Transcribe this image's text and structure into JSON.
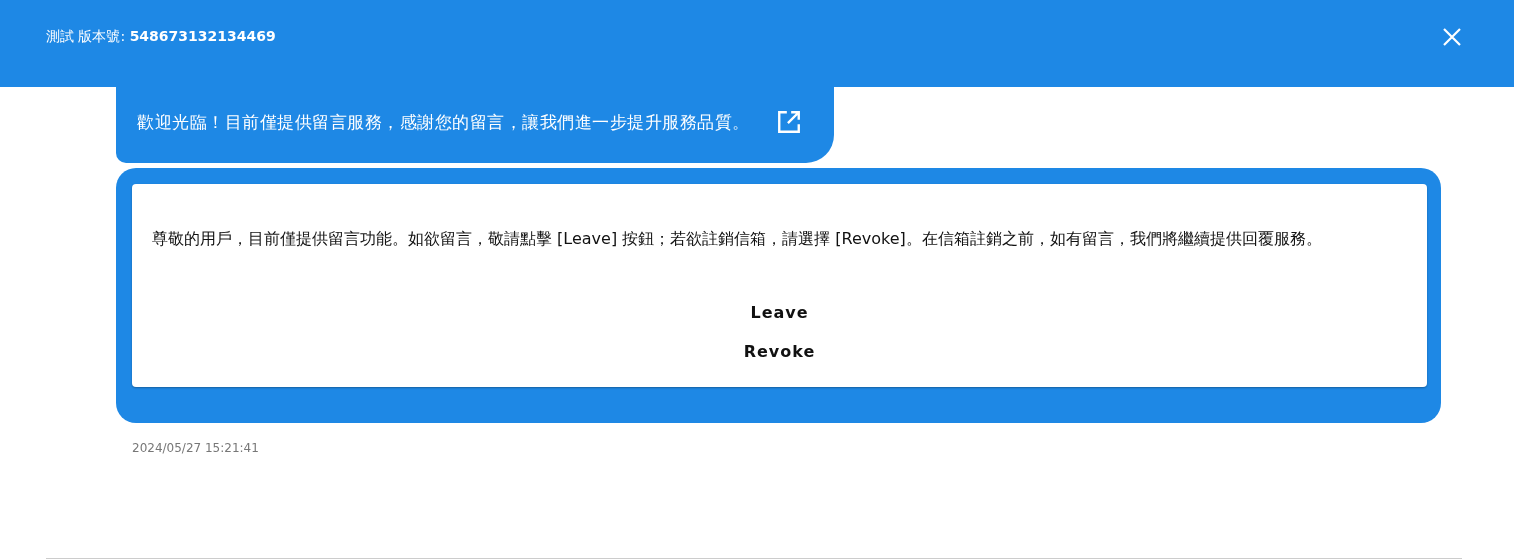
{
  "header": {
    "title": "測試 版本號: **548673132134469**"
  },
  "messages": [
    {
      "kind": "notice",
      "text": "歡迎光臨！目前僅提供留言服務，感謝您的留言，讓我們進一步提升服務品質。"
    },
    {
      "kind": "card",
      "text": "尊敬的用戶，目前僅提供留言功能。如欲留言，敬請點擊 [Leave] 按鈕；若欲註銷信箱，請選擇 [Revoke]。在信箱註銷之前，如有留言，我們將繼續提供回覆服務。",
      "buttons": [
        "Leave",
        "Revoke"
      ]
    }
  ],
  "timestamp": "2024/05/27 15:21:41"
}
